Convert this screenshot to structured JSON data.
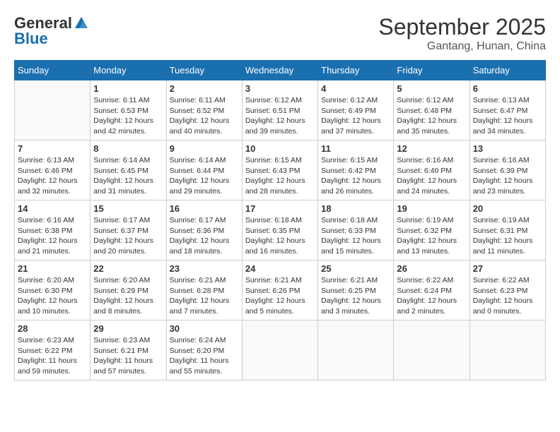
{
  "header": {
    "logo_general": "General",
    "logo_blue": "Blue",
    "title": "September 2025",
    "subtitle": "Gantang, Hunan, China"
  },
  "calendar": {
    "days_of_week": [
      "Sunday",
      "Monday",
      "Tuesday",
      "Wednesday",
      "Thursday",
      "Friday",
      "Saturday"
    ],
    "weeks": [
      [
        {
          "day": "",
          "sunrise": "",
          "sunset": "",
          "daylight": ""
        },
        {
          "day": "1",
          "sunrise": "6:11 AM",
          "sunset": "6:53 PM",
          "daylight": "12 hours and 42 minutes."
        },
        {
          "day": "2",
          "sunrise": "6:11 AM",
          "sunset": "6:52 PM",
          "daylight": "12 hours and 40 minutes."
        },
        {
          "day": "3",
          "sunrise": "6:12 AM",
          "sunset": "6:51 PM",
          "daylight": "12 hours and 39 minutes."
        },
        {
          "day": "4",
          "sunrise": "6:12 AM",
          "sunset": "6:49 PM",
          "daylight": "12 hours and 37 minutes."
        },
        {
          "day": "5",
          "sunrise": "6:12 AM",
          "sunset": "6:48 PM",
          "daylight": "12 hours and 35 minutes."
        },
        {
          "day": "6",
          "sunrise": "6:13 AM",
          "sunset": "6:47 PM",
          "daylight": "12 hours and 34 minutes."
        }
      ],
      [
        {
          "day": "7",
          "sunrise": "6:13 AM",
          "sunset": "6:46 PM",
          "daylight": "12 hours and 32 minutes."
        },
        {
          "day": "8",
          "sunrise": "6:14 AM",
          "sunset": "6:45 PM",
          "daylight": "12 hours and 31 minutes."
        },
        {
          "day": "9",
          "sunrise": "6:14 AM",
          "sunset": "6:44 PM",
          "daylight": "12 hours and 29 minutes."
        },
        {
          "day": "10",
          "sunrise": "6:15 AM",
          "sunset": "6:43 PM",
          "daylight": "12 hours and 28 minutes."
        },
        {
          "day": "11",
          "sunrise": "6:15 AM",
          "sunset": "6:42 PM",
          "daylight": "12 hours and 26 minutes."
        },
        {
          "day": "12",
          "sunrise": "6:16 AM",
          "sunset": "6:40 PM",
          "daylight": "12 hours and 24 minutes."
        },
        {
          "day": "13",
          "sunrise": "6:16 AM",
          "sunset": "6:39 PM",
          "daylight": "12 hours and 23 minutes."
        }
      ],
      [
        {
          "day": "14",
          "sunrise": "6:16 AM",
          "sunset": "6:38 PM",
          "daylight": "12 hours and 21 minutes."
        },
        {
          "day": "15",
          "sunrise": "6:17 AM",
          "sunset": "6:37 PM",
          "daylight": "12 hours and 20 minutes."
        },
        {
          "day": "16",
          "sunrise": "6:17 AM",
          "sunset": "6:36 PM",
          "daylight": "12 hours and 18 minutes."
        },
        {
          "day": "17",
          "sunrise": "6:18 AM",
          "sunset": "6:35 PM",
          "daylight": "12 hours and 16 minutes."
        },
        {
          "day": "18",
          "sunrise": "6:18 AM",
          "sunset": "6:33 PM",
          "daylight": "12 hours and 15 minutes."
        },
        {
          "day": "19",
          "sunrise": "6:19 AM",
          "sunset": "6:32 PM",
          "daylight": "12 hours and 13 minutes."
        },
        {
          "day": "20",
          "sunrise": "6:19 AM",
          "sunset": "6:31 PM",
          "daylight": "12 hours and 11 minutes."
        }
      ],
      [
        {
          "day": "21",
          "sunrise": "6:20 AM",
          "sunset": "6:30 PM",
          "daylight": "12 hours and 10 minutes."
        },
        {
          "day": "22",
          "sunrise": "6:20 AM",
          "sunset": "6:29 PM",
          "daylight": "12 hours and 8 minutes."
        },
        {
          "day": "23",
          "sunrise": "6:21 AM",
          "sunset": "6:28 PM",
          "daylight": "12 hours and 7 minutes."
        },
        {
          "day": "24",
          "sunrise": "6:21 AM",
          "sunset": "6:26 PM",
          "daylight": "12 hours and 5 minutes."
        },
        {
          "day": "25",
          "sunrise": "6:21 AM",
          "sunset": "6:25 PM",
          "daylight": "12 hours and 3 minutes."
        },
        {
          "day": "26",
          "sunrise": "6:22 AM",
          "sunset": "6:24 PM",
          "daylight": "12 hours and 2 minutes."
        },
        {
          "day": "27",
          "sunrise": "6:22 AM",
          "sunset": "6:23 PM",
          "daylight": "12 hours and 0 minutes."
        }
      ],
      [
        {
          "day": "28",
          "sunrise": "6:23 AM",
          "sunset": "6:22 PM",
          "daylight": "11 hours and 59 minutes."
        },
        {
          "day": "29",
          "sunrise": "6:23 AM",
          "sunset": "6:21 PM",
          "daylight": "11 hours and 57 minutes."
        },
        {
          "day": "30",
          "sunrise": "6:24 AM",
          "sunset": "6:20 PM",
          "daylight": "11 hours and 55 minutes."
        },
        {
          "day": "",
          "sunrise": "",
          "sunset": "",
          "daylight": ""
        },
        {
          "day": "",
          "sunrise": "",
          "sunset": "",
          "daylight": ""
        },
        {
          "day": "",
          "sunrise": "",
          "sunset": "",
          "daylight": ""
        },
        {
          "day": "",
          "sunrise": "",
          "sunset": "",
          "daylight": ""
        }
      ]
    ]
  }
}
